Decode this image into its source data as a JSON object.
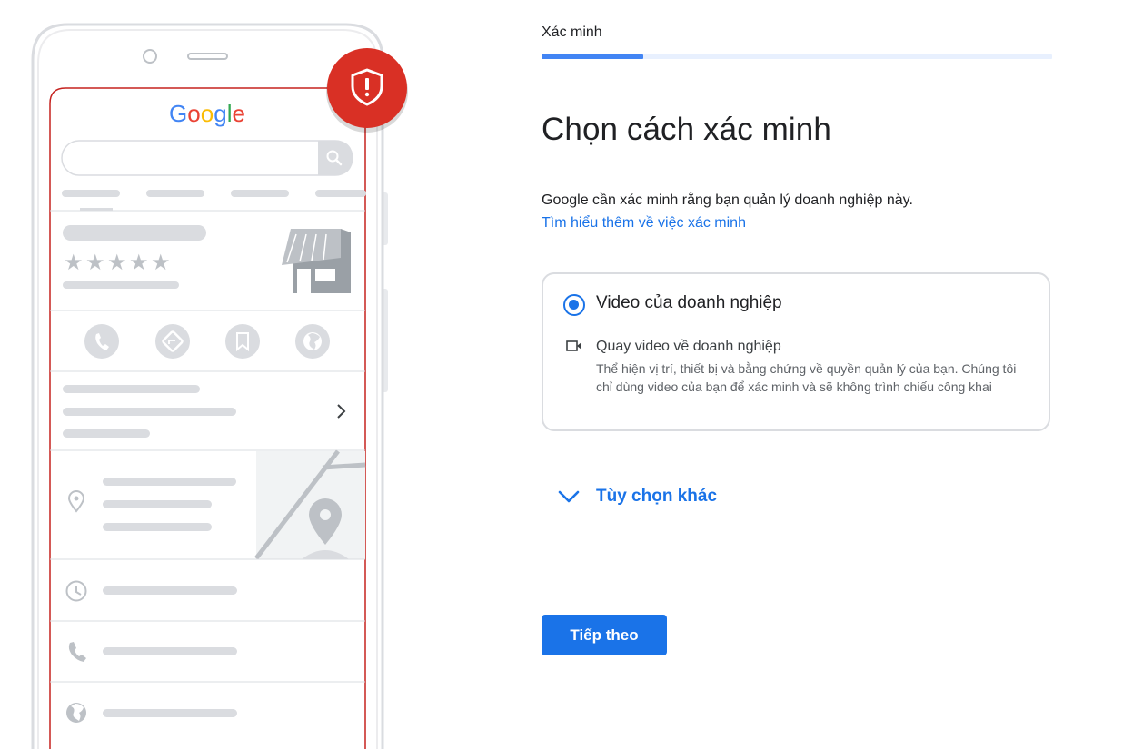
{
  "illustration": {
    "brand": [
      "G",
      "o",
      "o",
      "g",
      "l",
      "e"
    ],
    "brand_colors": [
      "#4285f4",
      "#ea4335",
      "#fbbc05",
      "#4285f4",
      "#34a853",
      "#ea4335"
    ],
    "badge_icon": "shield-alert-icon",
    "badge_color": "#d93025"
  },
  "progress": {
    "step_label": "Xác minh",
    "fraction": 0.2
  },
  "main": {
    "title": "Chọn cách xác minh",
    "description": "Google cần xác minh rằng bạn quản lý doanh nghiệp này.",
    "learn_more_link": "Tìm hiểu thêm về việc xác minh"
  },
  "option": {
    "title": "Video của doanh nghiệp",
    "selected": true,
    "method_icon": "video-camera-icon",
    "method_title": "Quay video về doanh nghiệp",
    "method_description": "Thể hiện vị trí, thiết bị và bằng chứng về quyền quản lý của bạn. Chúng tôi chỉ dùng video của bạn để xác minh và sẽ không trình chiếu công khai"
  },
  "more_options": {
    "label": "Tùy chọn khác",
    "icon": "chevron-down-icon"
  },
  "next_button": {
    "label": "Tiếp theo"
  },
  "colors": {
    "accent": "#1a73e8",
    "progress_fill": "#4285f4",
    "progress_track": "#e8f0fe",
    "card_border": "#dadce0"
  }
}
